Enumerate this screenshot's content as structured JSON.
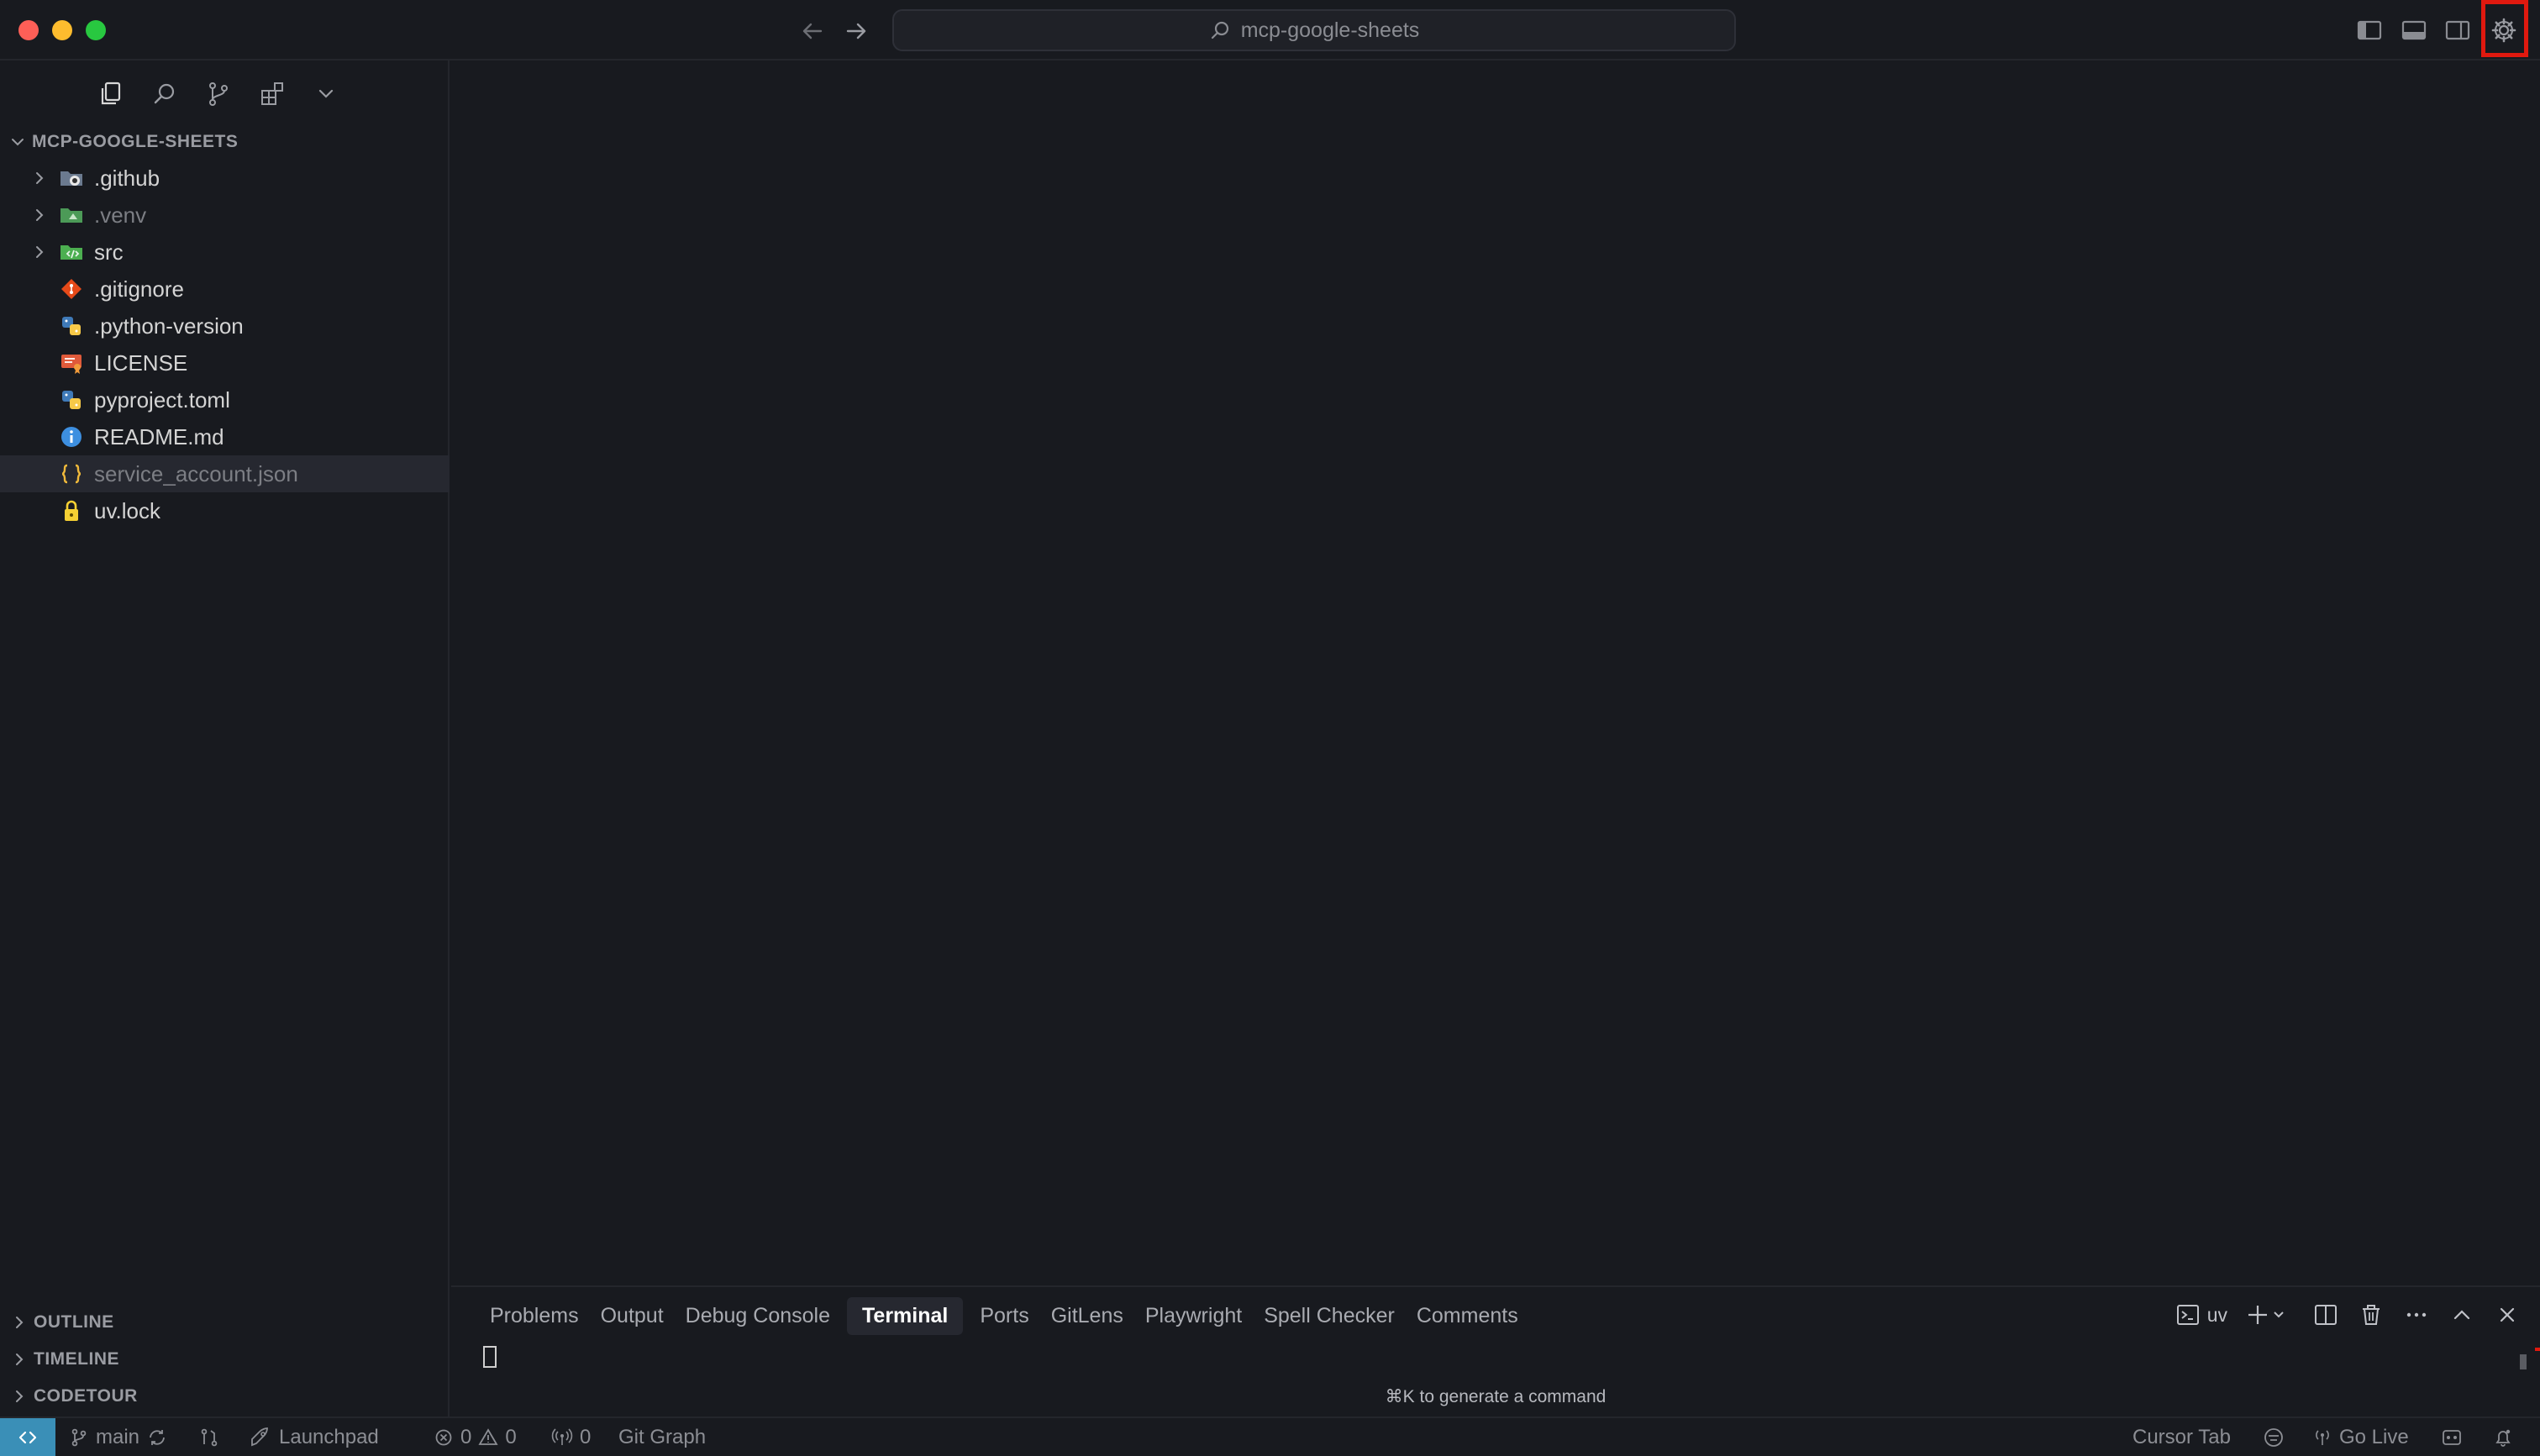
{
  "window": {
    "title": "mcp-google-sheets"
  },
  "colors": {
    "accent_remote": "#3a8fb7",
    "highlight": "#e0190f",
    "bg": "#181a1f"
  },
  "sidebar": {
    "section_title": "MCP-GOOGLE-SHEETS",
    "items": [
      {
        "name": ".github",
        "icon": "github-folder-icon"
      },
      {
        "name": ".venv",
        "icon": "venv-folder-icon"
      },
      {
        "name": "src",
        "icon": "src-folder-icon"
      },
      {
        "name": ".gitignore",
        "icon": "git-icon"
      },
      {
        "name": ".python-version",
        "icon": "python-icon"
      },
      {
        "name": "LICENSE",
        "icon": "license-icon"
      },
      {
        "name": "pyproject.toml",
        "icon": "python-icon"
      },
      {
        "name": "README.md",
        "icon": "info-icon"
      },
      {
        "name": "service_account.json",
        "icon": "json-icon"
      },
      {
        "name": "uv.lock",
        "icon": "lock-icon"
      }
    ],
    "bottom_sections": [
      "OUTLINE",
      "TIMELINE",
      "CODETOUR"
    ]
  },
  "panel": {
    "tabs": [
      "Problems",
      "Output",
      "Debug Console",
      "Terminal",
      "Ports",
      "GitLens",
      "Playwright",
      "Spell Checker",
      "Comments"
    ],
    "active_tab": "Terminal",
    "shell_label": "uv",
    "hint": "⌘K to generate a command"
  },
  "statusbar": {
    "branch": "main",
    "launchpad": "Launchpad",
    "errors": "0",
    "warnings": "0",
    "ports": "0",
    "git_graph": "Git Graph",
    "cursor_tab": "Cursor Tab",
    "go_live": "Go Live"
  }
}
